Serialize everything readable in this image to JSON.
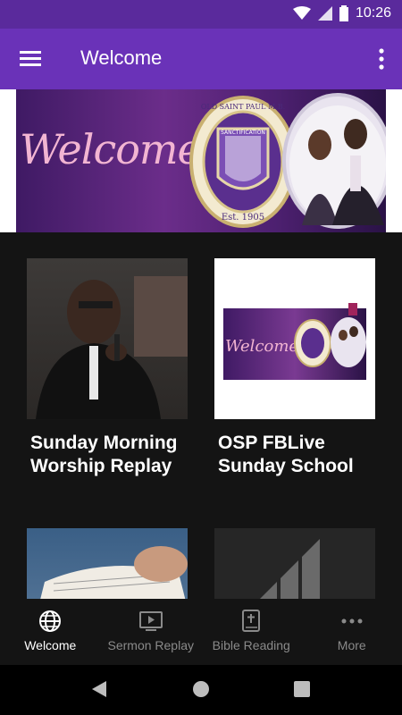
{
  "status": {
    "time": "10:26"
  },
  "appbar": {
    "title": "Welcome",
    "menu_icon": "hamburger-icon",
    "overflow_icon": "more-vertical-icon"
  },
  "banner": {
    "text": "Welcome",
    "seal_text": "OLD SAINT PAUL M.B.",
    "seal_badge": "SANCTIFICATION",
    "seal_year": "Est. 1905"
  },
  "cards": [
    {
      "title": "Sunday Morning Worship Replay"
    },
    {
      "title": "OSP FBLive Sunday School",
      "thumb_text": "Welcome"
    },
    {
      "title": ""
    },
    {
      "title": ""
    }
  ],
  "bottom_nav": {
    "items": [
      {
        "label": "Welcome",
        "icon": "globe-icon",
        "active": true
      },
      {
        "label": "Sermon Replay",
        "icon": "tv-play-icon",
        "active": false
      },
      {
        "label": "Bible Reading",
        "icon": "bible-icon",
        "active": false
      },
      {
        "label": "More",
        "icon": "more-horizontal-icon",
        "active": false
      }
    ]
  },
  "colors": {
    "status_bar": "#5a2a9c",
    "app_bar": "#6a32b8",
    "background": "#141414"
  }
}
